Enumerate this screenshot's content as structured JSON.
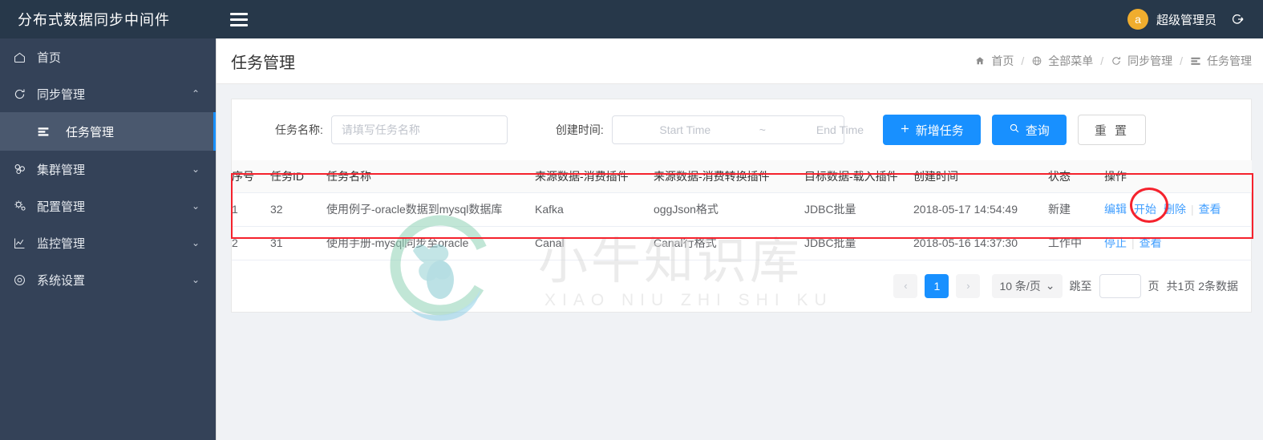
{
  "header": {
    "brand": "分布式数据同步中间件",
    "menu_toggle_icon": "hamburger-icon",
    "username": "超级管理员",
    "avatar_letter": "a",
    "avatar_color": "#f0ad2e",
    "logout_icon": "logout-icon",
    "background": "#27384a"
  },
  "sidebar": {
    "background": "#344258",
    "active_background": "#4a586e",
    "active_accent": "#1890ff",
    "items": [
      {
        "label": "首页",
        "icon": "home-icon",
        "arrow": "",
        "active": false
      },
      {
        "label": "同步管理",
        "icon": "sync-icon",
        "arrow": "⌃",
        "active": false,
        "expanded": true
      },
      {
        "label": "集群管理",
        "icon": "cluster-icon",
        "arrow": "⌄",
        "active": false
      },
      {
        "label": "配置管理",
        "icon": "settings-gear-icon",
        "arrow": "⌄",
        "active": false
      },
      {
        "label": "监控管理",
        "icon": "chart-monitor-icon",
        "arrow": "⌄",
        "active": false
      },
      {
        "label": "系统设置",
        "icon": "system-settings-icon",
        "arrow": "⌄",
        "active": false
      }
    ],
    "submenu": {
      "label": "任务管理",
      "icon": "task-list-icon",
      "active": true
    }
  },
  "page": {
    "title": "任务管理",
    "breadcrumb": [
      {
        "label": "首页",
        "icon": "home-solid-icon"
      },
      {
        "label": "全部菜单",
        "icon": "globe-icon"
      },
      {
        "label": "同步管理",
        "icon": "sync-icon"
      },
      {
        "label": "任务管理",
        "icon": "task-list-icon"
      }
    ],
    "breadcrumb_separator": "/"
  },
  "filter": {
    "task_name_label": "任务名称:",
    "task_name_value": "",
    "task_name_placeholder": "请填写任务名称",
    "create_time_label": "创建时间:",
    "start_time_value": "",
    "start_time_placeholder": "Start Time",
    "range_separator": "~",
    "end_time_value": "",
    "end_time_placeholder": "End Time",
    "calendar_icon": "calendar-icon",
    "add_button": "新增任务",
    "add_button_icon": "plus-icon",
    "search_button": "查询",
    "search_button_icon": "search-icon",
    "reset_button": "重 置",
    "primary_color": "#1890ff"
  },
  "table": {
    "columns": [
      "序号",
      "任务ID",
      "任务名称",
      "来源数据-消费插件",
      "来源数据-消费转换插件",
      "目标数据-载入插件",
      "创建时间",
      "状态",
      "操作"
    ],
    "rows": [
      {
        "index": "1",
        "task_id": "32",
        "task_name": "使用例子-oracle数据到mysql数据库",
        "source_consume_plugin": "Kafka",
        "source_transform_plugin": "oggJson格式",
        "target_load_plugin": "JDBC批量",
        "create_time": "2018-05-17 14:54:49",
        "status": "新建",
        "actions": [
          "编辑",
          "开始",
          "删除",
          "查看"
        ]
      },
      {
        "index": "2",
        "task_id": "31",
        "task_name": "使用手册-mysql同步至oracle",
        "source_consume_plugin": "Canal",
        "source_transform_plugin": "Canal行格式",
        "target_load_plugin": "JDBC批量",
        "create_time": "2018-05-16 14:37:30",
        "status": "工作中",
        "actions": [
          "停止",
          "查看"
        ]
      }
    ]
  },
  "pagination": {
    "prev_icon": "chevron-left-icon",
    "next_icon": "chevron-right-icon",
    "current_page": "1",
    "page_size": "10 条/页",
    "page_size_caret": "⌄",
    "jump_label": "跳至",
    "jump_value": "",
    "jump_suffix": "页",
    "total_text": "共1页 2条数据"
  },
  "watermark": {
    "text": "小牛知识库",
    "subtext": "XIAO NIU ZHI SHI KU",
    "logo": "ox-head-circle-logo"
  },
  "annotations": {
    "highlight_color": "#f5222d",
    "circled_action": "开始"
  }
}
